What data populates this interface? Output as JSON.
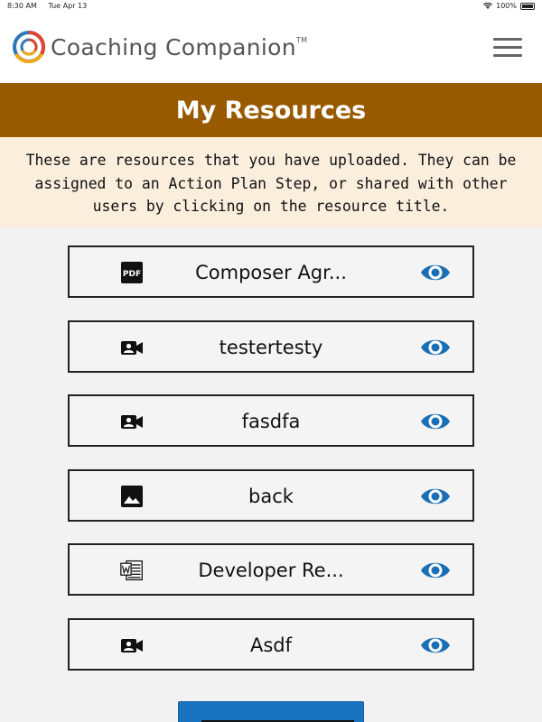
{
  "status_bar": {
    "time": "8:30 AM",
    "date": "Tue Apr 13",
    "battery": "100%"
  },
  "header": {
    "brand": "Coaching Companion",
    "trademark": "TM",
    "logo_icon": "coaching-companion-logo",
    "menu_icon": "hamburger-menu-icon"
  },
  "page": {
    "title": "My Resources",
    "intro": "These are resources that you have uploaded. They can be assigned to an Action Plan Step, or shared with other users by clicking on the resource title."
  },
  "resources": [
    {
      "name": "Composer Agr...",
      "type_icon": "pdf-icon",
      "action_icon": "eye-icon"
    },
    {
      "name": "testertesty",
      "type_icon": "video-icon",
      "action_icon": "eye-icon"
    },
    {
      "name": "fasdfa",
      "type_icon": "video-icon",
      "action_icon": "eye-icon"
    },
    {
      "name": "back",
      "type_icon": "image-icon",
      "action_icon": "eye-icon"
    },
    {
      "name": "Developer Re...",
      "type_icon": "word-doc-icon",
      "action_icon": "eye-icon"
    },
    {
      "name": "Asdf",
      "type_icon": "video-icon",
      "action_icon": "eye-icon"
    }
  ],
  "colors": {
    "title_bar": "#985a00",
    "intro_bg": "#fbeedd",
    "eye": "#1a6fb5",
    "button": "#1a73c0"
  },
  "upload_button": {
    "label": ""
  }
}
